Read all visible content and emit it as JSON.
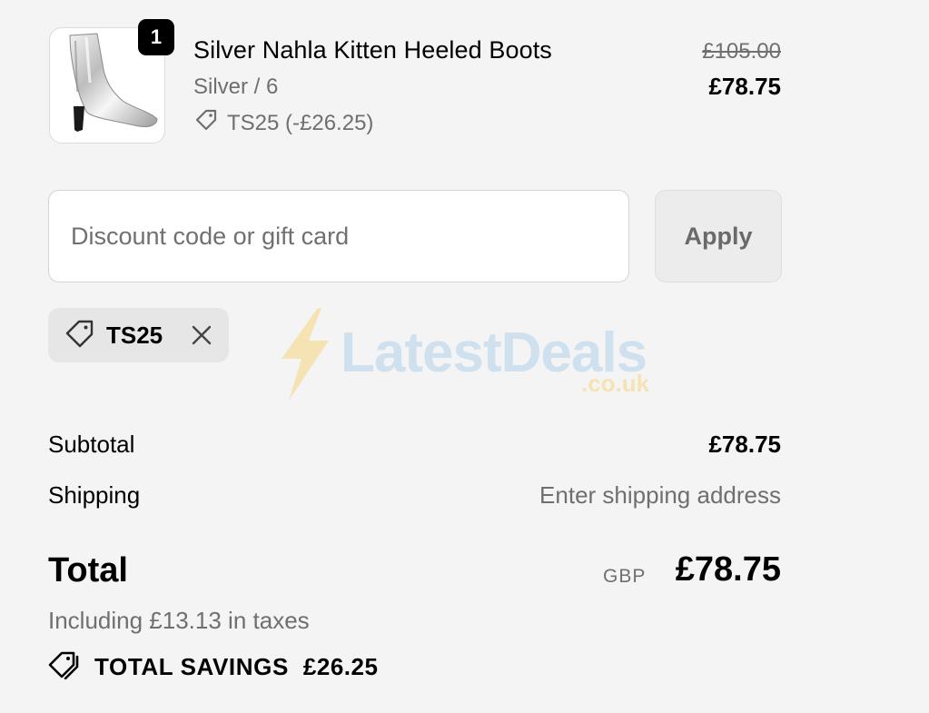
{
  "product": {
    "quantity": "1",
    "name": "Silver Nahla Kitten Heeled Boots",
    "variant": "Silver / 6",
    "discount_line": "TS25 (-£26.25)",
    "price_original": "£105.00",
    "price_current": "£78.75",
    "icon_tag": "tag-icon"
  },
  "discount": {
    "placeholder": "Discount code or gift card",
    "apply_label": "Apply",
    "applied_code": "TS25",
    "icon_remove": "close-icon"
  },
  "watermark": {
    "brand": "LatestDeals",
    "domain": ".co.uk"
  },
  "summary": {
    "subtotal_label": "Subtotal",
    "subtotal_value": "£78.75",
    "shipping_label": "Shipping",
    "shipping_value": "Enter shipping address",
    "total_label": "Total",
    "total_currency": "GBP",
    "total_value": "£78.75",
    "taxes_note": "Including £13.13 in taxes",
    "savings_label": "TOTAL SAVINGS",
    "savings_value": "£26.25"
  },
  "colors": {
    "background": "#f4f4f4",
    "muted_text": "#6f6f6f",
    "badge": "#000000",
    "watermark_blue": "#cfe0ef",
    "watermark_yellow": "#f6e3b3"
  }
}
